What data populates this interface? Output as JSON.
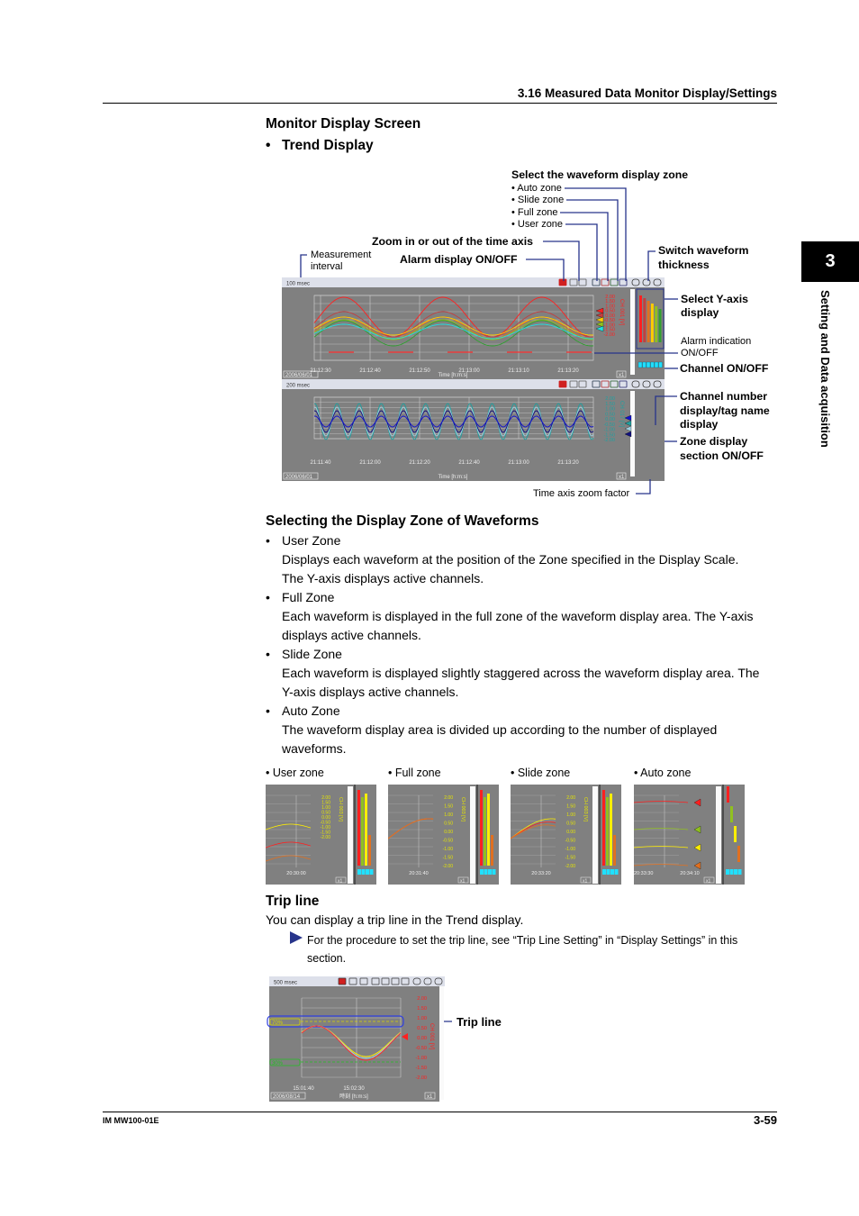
{
  "header": {
    "section": "3.16  Measured Data Monitor Display/Settings"
  },
  "side_tab": {
    "number": "3",
    "label": "Setting and Data acquisition"
  },
  "monitor": {
    "title": "Monitor Display Screen",
    "subtitle": "Trend Display"
  },
  "callouts": {
    "zone_title": "Select the waveform display zone",
    "zone_items": [
      "• Auto zone",
      "• Slide zone",
      "• Full zone",
      "• User zone"
    ],
    "zoom": "Zoom in or out of the time axis",
    "meas_interval": [
      "Measurement",
      "interval"
    ],
    "alarm": "Alarm display ON/OFF",
    "thickness": [
      "Switch waveform",
      "thickness"
    ],
    "yaxis": [
      "Select Y-axis",
      "display"
    ],
    "alarm_ind": [
      "Alarm indication",
      "ON/OFF"
    ],
    "channel_onoff": "Channel ON/OFF",
    "channel_num": [
      "Channel number",
      "display/tag name",
      "display"
    ],
    "zone_display": [
      "Zone display",
      "section ON/OFF"
    ],
    "time_zoom": "Time axis zoom factor"
  },
  "screen1": {
    "interval": "100 msec",
    "date": "2006/06/01",
    "xlabel": "Time [h:m:s]",
    "zoom": "x1",
    "ticks": [
      "21:12:30",
      "21:12:40",
      "21:12:50",
      "21:13:00",
      "21:13:10",
      "21:13:20"
    ],
    "scale": [
      "2.00",
      "1.50",
      "1.00",
      "0.50",
      "0.00",
      "-0.50",
      "-1.00",
      "-1.50",
      "-2.00"
    ],
    "channel": "CH 001 [V]",
    "colors": [
      "#ff2020",
      "#c04040",
      "#e07020",
      "#ffcc00",
      "#90c020",
      "#30a030",
      "#20e0e0"
    ]
  },
  "screen2": {
    "interval": "200 msec",
    "date": "2006/06/01",
    "xlabel": "Time [h:m:s]",
    "zoom": "x1",
    "ticks": [
      "21:11:40",
      "21:12:00",
      "21:12:20",
      "21:12:40",
      "21:13:00",
      "21:13:20"
    ],
    "scale": [
      "2.00",
      "1.50",
      "1.00",
      "0.50",
      "0.00",
      "-0.50",
      "-1.00",
      "-1.50",
      "-2.00"
    ],
    "channel": "CH 017 [V]",
    "colors": [
      "#1010d0",
      "#20a0a0",
      "#a0d0e0",
      "#101080"
    ]
  },
  "selecting": {
    "title": "Selecting the Display Zone of Waveforms",
    "items": [
      {
        "name": "User Zone",
        "lines": [
          "Displays each waveform at the position of the Zone specified in the Display Scale.",
          "The Y-axis displays active channels."
        ]
      },
      {
        "name": "Full Zone",
        "lines": [
          "Each waveform is displayed in the full zone of the waveform display area. The Y-axis",
          "displays active channels."
        ]
      },
      {
        "name": "Slide Zone",
        "lines": [
          "Each waveform is displayed slightly staggered across the waveform display area. The",
          "Y-axis displays active channels."
        ]
      },
      {
        "name": "Auto Zone",
        "lines": [
          "The waveform display area is divided up according to the number of displayed",
          "waveforms."
        ]
      }
    ]
  },
  "thumbs": [
    {
      "label": "• User zone",
      "tick": "20:30:00",
      "channel": "CH 003 [V]",
      "zoom": "x1"
    },
    {
      "label": "• Full zone",
      "tick": "20:31:40",
      "channel": "CH 003 [V]",
      "zoom": "x1"
    },
    {
      "label": "• Slide zone",
      "tick": "20:33:20",
      "channel": "CH 003 [V]",
      "zoom": "x1"
    },
    {
      "label": "• Auto zone",
      "tick": "20:34:10",
      "tick0": "20:33:30",
      "zoom": "x1"
    }
  ],
  "thumb_scale": [
    "2.00",
    "1.50",
    "1.00",
    "0.50",
    "0.00",
    "-0.50",
    "-1.00",
    "-1.50",
    "-2.00"
  ],
  "trip": {
    "title": "Trip line",
    "text": "You can display a trip line in the Trend display.",
    "note": [
      "For the procedure to set the trip line, see “Trip Line Setting” in “Display Settings” in this",
      "section."
    ],
    "callout": "Trip line",
    "screen": {
      "interval": "500 msec",
      "date": "2006/08/14",
      "xlabel": "時刻 [h:m:s]",
      "zoom": "x1",
      "ticks": [
        "15:01:40",
        "15:02:30"
      ],
      "trip_high": "70%",
      "trip_low": "30%",
      "channel": "CH 001 [V]"
    }
  },
  "footer": {
    "doc": "IM MW100-01E",
    "page": "3-59"
  }
}
